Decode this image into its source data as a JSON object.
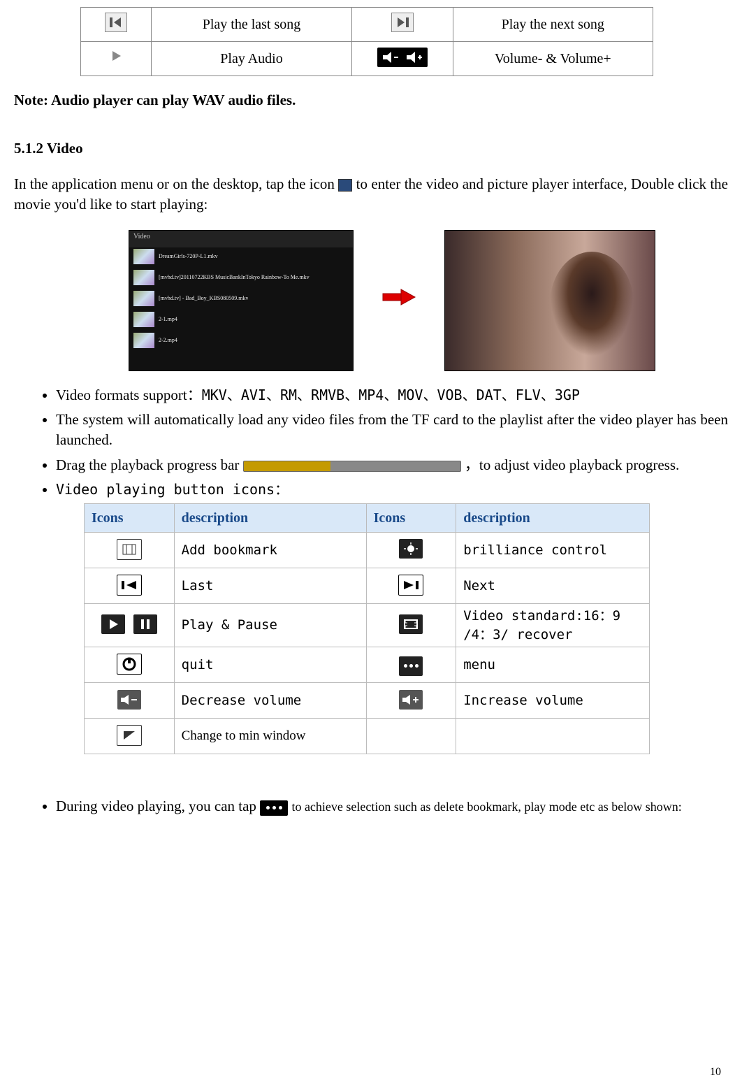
{
  "audio_table": {
    "r1c2": "Play the last song",
    "r1c4": "Play the next song",
    "r2c2": "Play Audio",
    "r2c4": "Volume- & Volume+"
  },
  "note": "Note: Audio player can play WAV audio files.",
  "video_section": {
    "heading": "5.1.2 Video",
    "intro_a": "In the application menu or on the desktop, tap the icon ",
    "intro_b": " to enter the video and picture player interface, ",
    "intro_c": "Double click the movie you'd like to start playing:",
    "screenshot_title": "Video",
    "file1": "DreamGirls-720P-L1.mkv",
    "file2": "[mvhd.tv]20110722KBS MusicBankInTokyo Rainbow-To Me.mkv",
    "file3": "[mvhd.tv] - Bad_Boy_KBS080509.mkv",
    "file4": "2-1.mp4",
    "file5": "2-2.mp4"
  },
  "bullets": {
    "formats_label": "Video formats support：",
    "formats_list": "MKV、AVI、RM、RMVB、MP4、MOV、VOB、DAT、FLV、3GP",
    "auto_load": "The system will automatically load any video files from the TF card to the playlist after the video player has been launched.",
    "drag_a": "Drag the playback progress bar ",
    "drag_b": "，to adjust video playback progress.",
    "icons_intro": "Video playing button icons："
  },
  "video_table": {
    "h_icons": "Icons",
    "h_desc": "description",
    "r1a": "Add bookmark",
    "r1b": "brilliance control",
    "r2a": "Last",
    "r2b": "Next",
    "r3a": "Play & Pause",
    "r3b": "Video standard:16：9 /4：3/ recover",
    "r4a": "quit",
    "r4b": "menu",
    "r5a": "Decrease volume",
    "r5b": "Increase volume",
    "r6a": "Change to min window"
  },
  "during": {
    "a": "During video playing, you can tap ",
    "b": " to achieve selection such as delete bookmark, play mode etc as below shown:"
  },
  "page_number": "10"
}
